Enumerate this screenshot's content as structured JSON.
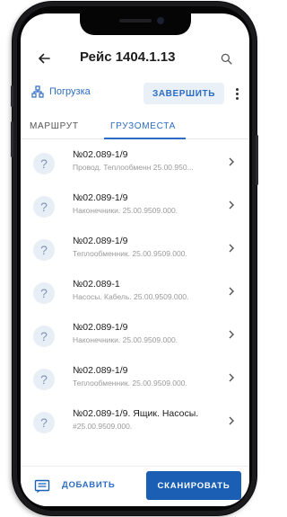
{
  "header": {
    "title": "Рейс 1404.1.13",
    "back_icon": "arrow-left-icon",
    "search_icon": "search-icon"
  },
  "status": {
    "label": "Погрузка",
    "icon": "hierarchy-icon",
    "finish_label": "ЗАВЕРШИТЬ",
    "more_icon": "more-vertical-icon"
  },
  "tabs": [
    {
      "label": "МАРШРУТ",
      "active": false
    },
    {
      "label": "ГРУЗОМЕСТА",
      "active": true
    }
  ],
  "items": [
    {
      "icon": "?",
      "title": "№02.089-1/9",
      "subtitle": "Провод. Теплообменн 25.00.950..."
    },
    {
      "icon": "?",
      "title": "№02.089-1/9",
      "subtitle": "Наконечники. 25.00.9509.000."
    },
    {
      "icon": "?",
      "title": "№02.089-1/9",
      "subtitle": "Теплообменник. 25.00.9509.000."
    },
    {
      "icon": "?",
      "title": "№02.089-1",
      "subtitle": "Насосы. Кабель. 25.00.9509.000."
    },
    {
      "icon": "?",
      "title": "№02.089-1/9",
      "subtitle": "Наконечники. 25.00.9509.000."
    },
    {
      "icon": "?",
      "title": "№02.089-1/9",
      "subtitle": "Теплообменник. 25.00.9509.000."
    },
    {
      "icon": "?",
      "title": "№02.089-1/9. Ящик. Насосы.",
      "subtitle": "#25.00.9509.000."
    }
  ],
  "bottom": {
    "add_label": "ДОБАВИТЬ",
    "scan_label": "СКАНИРОВАТЬ",
    "notes_icon": "notes-icon"
  },
  "colors": {
    "accent": "#2b6cc4",
    "primary_button": "#1a5fb4",
    "finish_bg": "#eaf0f8"
  }
}
